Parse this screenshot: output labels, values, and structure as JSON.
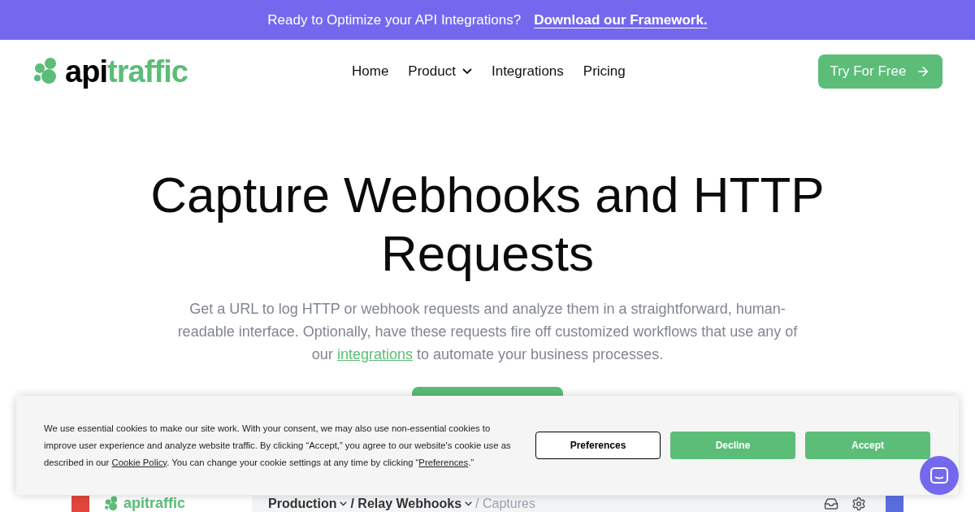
{
  "announcement": {
    "text": "Ready to Optimize your API Integrations?",
    "link": "Download our Framework."
  },
  "logo": {
    "part_1": "api",
    "part_2": "traffic"
  },
  "nav": [
    {
      "label": "Home",
      "dropdown": false
    },
    {
      "label": "Product",
      "dropdown": true
    },
    {
      "label": "Integrations",
      "dropdown": false
    },
    {
      "label": "Pricing",
      "dropdown": false
    }
  ],
  "cta": {
    "label": "Try For Free"
  },
  "hero": {
    "title": "Capture Webhooks and HTTP Requests",
    "subtitle_before": "Get a URL to log HTTP or webhook requests and analyze them in a straightforward, human-readable interface. Optionally, have these requests fire off customized workflows that use any of our",
    "subtitle_link": "integrations",
    "subtitle_after": "to automate your business processes."
  },
  "app_preview": {
    "logo": "apitraffic",
    "breadcrumbs": [
      {
        "label": "Production",
        "dropdown": true
      },
      {
        "label": "/ Relay Webhooks",
        "dropdown": true
      },
      {
        "label": "/ Captures",
        "dropdown": false
      }
    ]
  },
  "cookie_banner": {
    "text_1": "We use essential cookies to make our site work. With your consent, we may also use non-essential cookies to improve user experience and analyze website traffic. By clicking “Accept,” you agree to our website's cookie use as described in our",
    "policy_link": "Cookie Policy",
    "text_2": ". You can change your cookie settings at any time by clicking “",
    "preferences_link": "Preferences",
    "text_3": ".”",
    "buttons": [
      {
        "label": "Preferences",
        "kind": "outline"
      },
      {
        "label": "Decline",
        "kind": "filled"
      },
      {
        "label": "Accept",
        "kind": "filled"
      }
    ]
  }
}
